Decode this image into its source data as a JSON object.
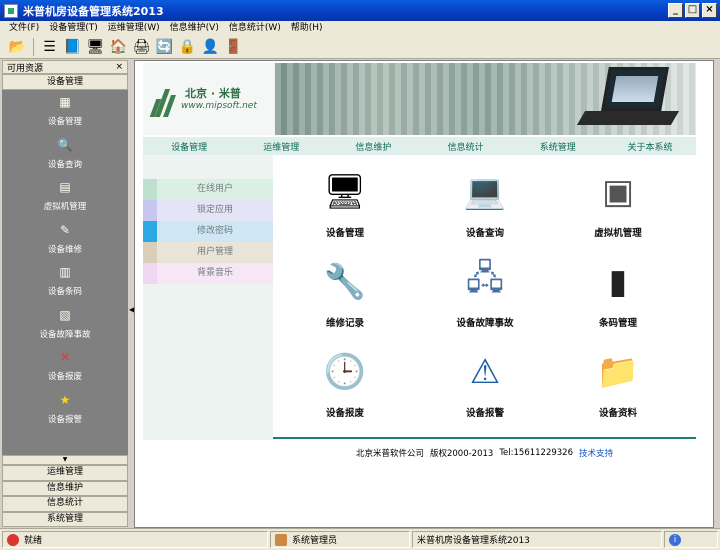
{
  "window": {
    "title": "米普机房设备管理系统2013",
    "min": "_",
    "max": "□",
    "close": "×"
  },
  "menu": [
    "文件(F)",
    "设备管理(T)",
    "运维管理(W)",
    "信息维护(V)",
    "信息统计(W)",
    "帮助(H)"
  ],
  "toolbar": {
    "icons": [
      "open-folder-icon",
      "list-icon",
      "book-icon",
      "monitor-icon",
      "home-icon",
      "printer-icon",
      "refresh-icon",
      "lock-icon",
      "user-icon",
      "exit-icon"
    ],
    "glyphs": [
      "📂",
      "☰",
      "📘",
      "🖥",
      "🏠",
      "🖨",
      "🔄",
      "🔒",
      "👤",
      "🚪"
    ]
  },
  "left_panel": {
    "title": "可用资源",
    "close": "×",
    "group": "设备管理",
    "items": [
      {
        "label": "设备管理",
        "icon": "▦"
      },
      {
        "label": "设备查询",
        "icon": "🔍"
      },
      {
        "label": "虚拟机管理",
        "icon": "▤"
      },
      {
        "label": "设备维修",
        "icon": "✎"
      },
      {
        "label": "设备条码",
        "icon": "▥"
      },
      {
        "label": "设备故障事故",
        "icon": "▧"
      },
      {
        "label": "设备报废",
        "icon": "✕"
      },
      {
        "label": "设备报警",
        "icon": "★"
      }
    ],
    "collapse": "▼",
    "groups": [
      "运维管理",
      "信息维护",
      "信息统计",
      "系统管理"
    ],
    "splitter_arrow": "◀"
  },
  "banner": {
    "logo_cn": "北京 · 米普",
    "logo_url": "www.mipsoft.net"
  },
  "top_nav": [
    "设备管理",
    "运维管理",
    "信息维护",
    "信息统计",
    "系统管理",
    "关于本系统"
  ],
  "sub_nav": [
    {
      "label": "在线用户",
      "color": "#bde0cf",
      "bg": "#dcefe5"
    },
    {
      "label": "锁定应用",
      "color": "#c6c6ee",
      "bg": "#e4e4f6"
    },
    {
      "label": "修改密码",
      "color": "#2ca9e4",
      "bg": "#cfe7f4"
    },
    {
      "label": "用户管理",
      "color": "#d9cfb9",
      "bg": "#e9e4d7"
    },
    {
      "label": "背景音乐",
      "color": "#f0d6f0",
      "bg": "#f6e6f6"
    }
  ],
  "tiles": [
    {
      "label": "设备管理",
      "glyph": "🖥",
      "icon": "monitor-icon"
    },
    {
      "label": "设备查询",
      "glyph": "💻",
      "icon": "computer-icon"
    },
    {
      "label": "虚拟机管理",
      "glyph": "▣",
      "icon": "vmware-icon"
    },
    {
      "label": "维修记录",
      "glyph": "🔧",
      "icon": "wrench-icon"
    },
    {
      "label": "设备故障事故",
      "glyph": "🖧",
      "icon": "server-error-icon"
    },
    {
      "label": "条码管理",
      "glyph": "▮",
      "icon": "barcode-icon"
    },
    {
      "label": "设备报废",
      "glyph": "🕒",
      "icon": "clock-icon"
    },
    {
      "label": "设备报警",
      "glyph": "⚠",
      "icon": "alert-icon"
    },
    {
      "label": "设备资料",
      "glyph": "📁",
      "icon": "folder-icon"
    }
  ],
  "footer": {
    "company": "北京米普软件公司",
    "copyright": "版权2000-2013",
    "phone": "Tel:15611229326",
    "support": "技术支持"
  },
  "status": {
    "ready": "就绪",
    "user": "系统管理员",
    "app": "米普机房设备管理系统2013"
  }
}
